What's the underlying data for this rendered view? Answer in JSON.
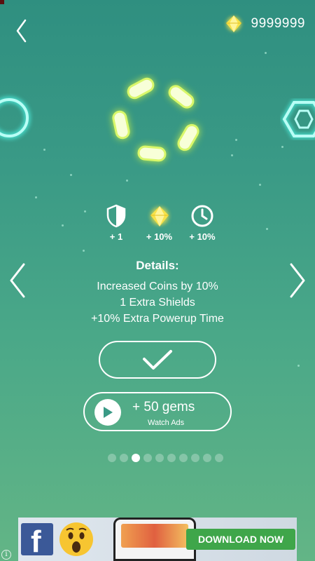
{
  "header": {
    "gem_count": "9999999"
  },
  "perks": [
    {
      "icon": "shield-icon",
      "value": "+ 1"
    },
    {
      "icon": "gem-icon",
      "value": "+ 10%"
    },
    {
      "icon": "clock-icon",
      "value": "+ 10%"
    }
  ],
  "details": {
    "title": "Details:",
    "lines": [
      "Increased Coins by 10%",
      "1 Extra Shields",
      "+10% Extra Powerup Time"
    ]
  },
  "watch_ad": {
    "label": "+ 50 gems",
    "sublabel": "Watch Ads"
  },
  "pager": {
    "total": 10,
    "active_index": 2
  },
  "ad": {
    "cta_label": "DOWNLOAD NOW",
    "info_glyph": "i"
  },
  "colors": {
    "background_top": "#2f8f80",
    "background_bottom": "#63b586",
    "skin_glow": "#c8f04a",
    "neon_cyan": "#4ff5e6",
    "gem_yellow": "#f7e24a",
    "cta_green": "#3fa64a"
  }
}
